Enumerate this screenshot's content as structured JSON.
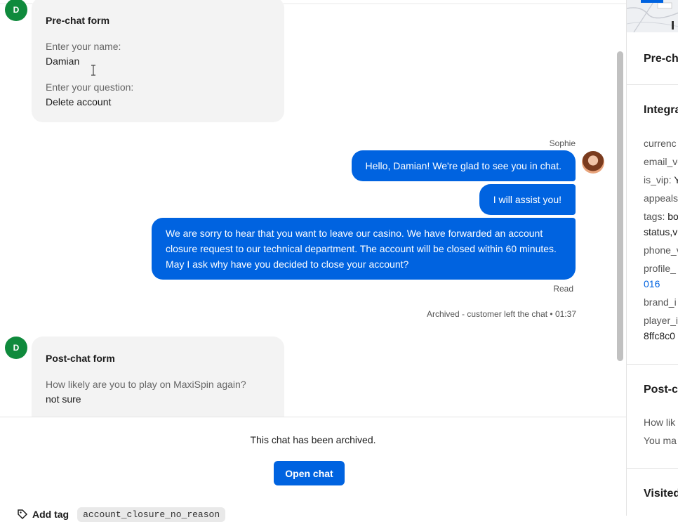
{
  "chat": {
    "pre_chat": {
      "avatar_initial": "D",
      "title": "Pre-chat form",
      "name_label": "Enter your name:",
      "name_value": "Damian",
      "question_label": "Enter your question:",
      "question_value": "Delete account"
    },
    "agent": {
      "name": "Sophie"
    },
    "messages": [
      "Hello, Damian! We're glad to see you in chat.",
      "I will assist you!",
      "We are sorry to hear that you want to leave our casino. We have forwarded an account closure request to our technical department. The account will be closed within 60 minutes. May I ask why have you decided to close your account?"
    ],
    "read_status": "Read",
    "archive_note": "Archived - customer left the chat • 01:37",
    "post_chat": {
      "avatar_initial": "D",
      "title": "Post-chat form",
      "question_label": "How likely are you to play on MaxiSpin again?",
      "question_value": "not sure"
    }
  },
  "footer": {
    "archived_text": "This chat has been archived.",
    "open_chat_label": "Open chat",
    "add_tag_label": "Add tag",
    "tag": "account_closure_no_reason"
  },
  "sidebar": {
    "pre_chat_title": "Pre-ch",
    "integrations_title": "Integra",
    "fields": [
      {
        "key": "currenc",
        "value": ""
      },
      {
        "key": "email_ve",
        "value": ""
      },
      {
        "key": "is_vip: ",
        "value": "Y"
      },
      {
        "key": "appeals",
        "value": ""
      },
      {
        "key": "tags: ",
        "value": "bo"
      }
    ],
    "tags_cont": "status,v",
    "phone": "phone_v",
    "profile": "profile_",
    "profile_link": "016",
    "brand": "brand_i",
    "player": "player_i",
    "player_id": "8ffc8c0",
    "post_chat_title": "Post-c",
    "post_line1": "How lik",
    "post_line2": "You ma",
    "visited_title": "Visited"
  },
  "colors": {
    "accent": "#0063e0",
    "avatar_green": "#0f8a3c"
  }
}
